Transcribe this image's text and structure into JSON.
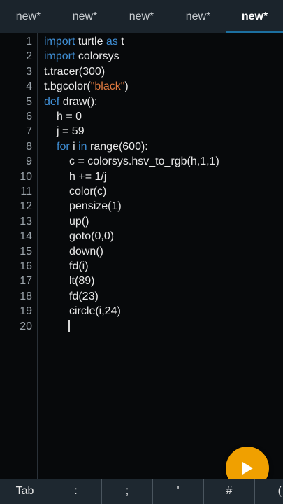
{
  "tabs": [
    {
      "label": "new*"
    },
    {
      "label": "new*"
    },
    {
      "label": "new*"
    },
    {
      "label": "new*"
    },
    {
      "label": "new*"
    }
  ],
  "code": {
    "line_numbers": [
      "1",
      "2",
      "3",
      "4",
      "5",
      "6",
      "7",
      "8",
      "9",
      "10",
      "11",
      "12",
      "13",
      "14",
      "15",
      "16",
      "17",
      "18",
      "19",
      "20"
    ],
    "lines": [
      {
        "kw1": "import",
        "t1": " turtle ",
        "kw2": "as",
        "t2": " t"
      },
      {
        "kw1": "import",
        "t1": " colorsys"
      },
      {
        "t1": "t.tracer(300)"
      },
      {
        "t1": "t.bgcolor(",
        "str": "\"black\"",
        "t2": ")"
      },
      {
        "kw1": "def",
        "t1": " draw():"
      },
      {
        "t1": "h = 0"
      },
      {
        "t1": "j = 59"
      },
      {
        "kw1": "for",
        "t1": " i ",
        "kw2": "in",
        "t2": " range(600):"
      },
      {
        "t1": "c = colorsys.hsv_to_rgb(h,1,1)"
      },
      {
        "t1": "h += 1/j"
      },
      {
        "t1": "color(c)"
      },
      {
        "t1": "pensize(1)"
      },
      {
        "t1": "up()"
      },
      {
        "t1": "goto(0,0)"
      },
      {
        "t1": "down()"
      },
      {
        "t1": "fd(i)"
      },
      {
        "t1": "lt(89)"
      },
      {
        "t1": "fd(23)"
      },
      {
        "t1": "circle(i,24)"
      },
      {
        "t1": ""
      }
    ]
  },
  "run_button": {
    "icon": "play-icon"
  },
  "keyboard_bar": {
    "keys": [
      "Tab",
      ":",
      ";",
      "'",
      "#",
      "("
    ]
  },
  "colors": {
    "keyword": "#3f8fd6",
    "string": "#e07a3f",
    "run_button": "#f0a000",
    "background": "#07090b",
    "tab_bar": "#1b242c"
  }
}
